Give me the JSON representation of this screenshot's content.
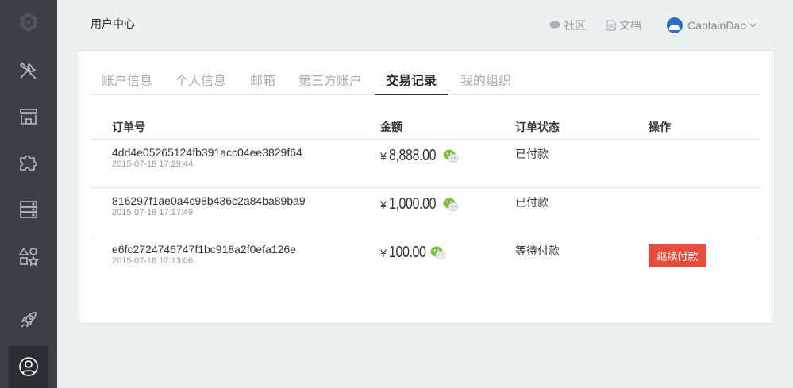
{
  "sidebar": {
    "items": [
      {
        "icon": "logo-icon"
      },
      {
        "icon": "tools-icon"
      },
      {
        "icon": "store-icon"
      },
      {
        "icon": "puzzle-icon"
      },
      {
        "icon": "server-icon"
      },
      {
        "icon": "shapes-icon"
      },
      {
        "icon": "rocket-icon"
      },
      {
        "icon": "user-circle-icon",
        "active": true
      }
    ]
  },
  "header": {
    "title": "用户中心",
    "links": {
      "community": "社区",
      "docs": "文档"
    },
    "username": "CaptainDao"
  },
  "tabs": [
    "账户信息",
    "个人信息",
    "邮箱",
    "第三方账户",
    "交易记录",
    "我的组织"
  ],
  "active_tab": "交易记录",
  "table": {
    "headers": [
      "订单号",
      "金额",
      "订单状态",
      "操作"
    ],
    "rows": [
      {
        "order_no": "4dd4e05265124fb391acc04ee3829f64",
        "time": "2015-07-18 17:29:44",
        "currency": "¥",
        "amount": "8,888.00",
        "status": "已付款",
        "action": ""
      },
      {
        "order_no": "816297f1ae0a4c98b436c2a84ba89ba9",
        "time": "2015-07-18 17:17:49",
        "currency": "¥",
        "amount": "1,000.00",
        "status": "已付款",
        "action": ""
      },
      {
        "order_no": "e6fc2724746747f1bc918a2f0efa126e",
        "time": "2015-07-18 17:13:06",
        "currency": "¥",
        "amount": "100.00",
        "status": "等待付款",
        "action": "继续付款"
      }
    ]
  },
  "colors": {
    "sidebar": "#3a3f45",
    "accent_button": "#e74c3c",
    "wechat_green": "#7cc242"
  }
}
